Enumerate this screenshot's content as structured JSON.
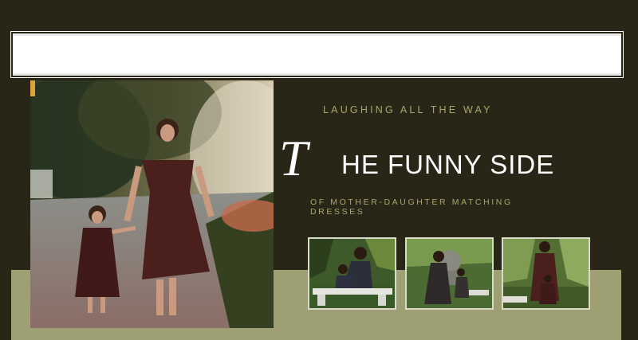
{
  "headline": {
    "kicker": "LAUGHING ALL THE WAY",
    "script_letter": "T",
    "title_rest": "HE FUNNY SIDE",
    "subtitle": "OF MOTHER-DAUGHTER MATCHING DRESSES"
  },
  "images": {
    "hero": "mother-daughter-walking-photo",
    "thumbnails": [
      "mother-daughter-bench-photo",
      "mother-daughter-garden-statue-photo",
      "mother-daughter-standing-photo"
    ]
  },
  "colors": {
    "background": "#2a2617",
    "panel": "#9ea073",
    "accent_text": "#a5a76e",
    "title": "#ffffff"
  }
}
